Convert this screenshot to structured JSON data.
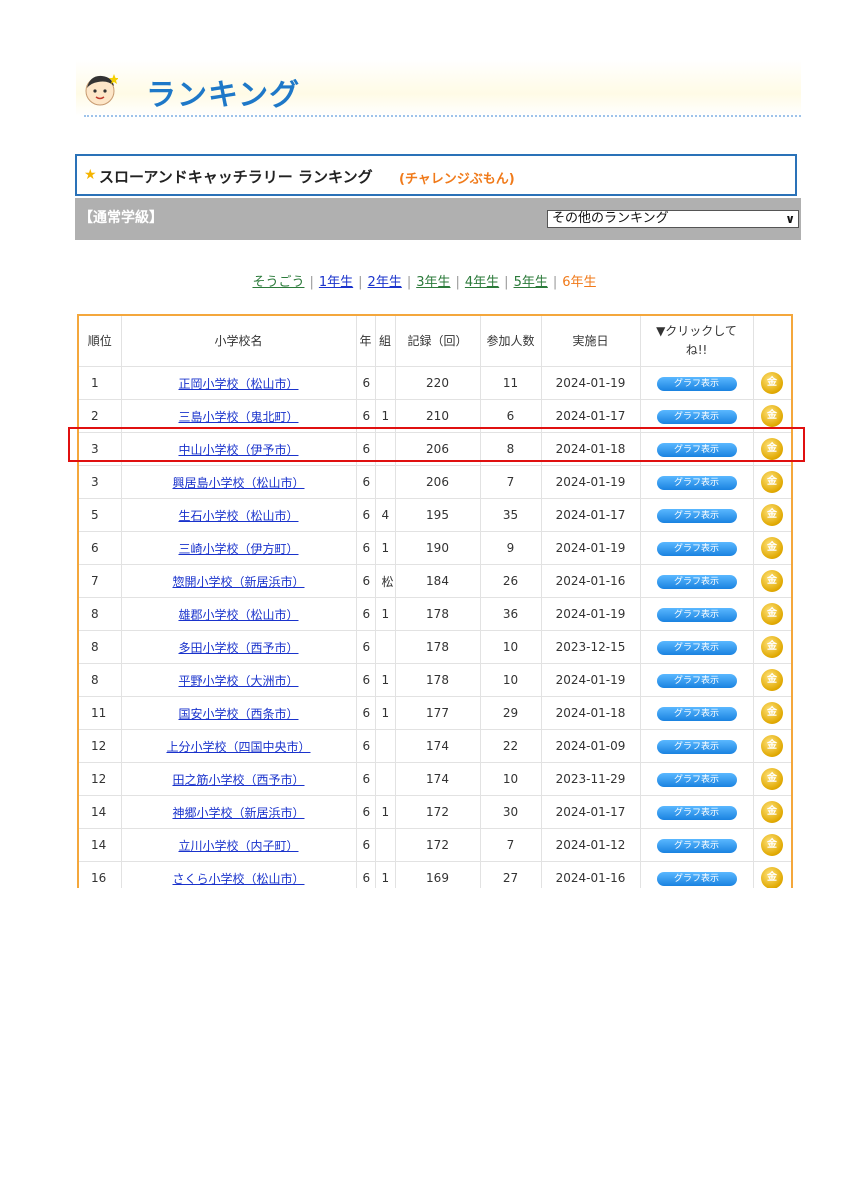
{
  "header": {
    "title": "ランキング"
  },
  "ranking_box": {
    "title": "スローアンドキャッチラリー ランキング",
    "subtitle": "(チャレンジぶもん)"
  },
  "class_bar": {
    "label": "【通常学級】",
    "select_value": "その他のランキング"
  },
  "grade_nav": [
    {
      "label": "そうごう",
      "style": "green"
    },
    {
      "label": "1年生",
      "style": "blue"
    },
    {
      "label": "2年生",
      "style": "blue"
    },
    {
      "label": "3年生",
      "style": "green"
    },
    {
      "label": "4年生",
      "style": "green"
    },
    {
      "label": "5年生",
      "style": "green"
    },
    {
      "label": "6年生",
      "style": "current"
    }
  ],
  "table": {
    "headers": [
      "順位",
      "小学校名",
      "年",
      "組",
      "記録（回）",
      "参加人数",
      "実施日",
      "▼クリックしてね!!",
      ""
    ],
    "graph_label": "グラフ表示",
    "medal_label": "金",
    "rows": [
      [
        "1",
        "正岡小学校（松山市）",
        "6",
        "",
        "220",
        "11",
        "2024-01-19"
      ],
      [
        "2",
        "三島小学校（鬼北町）",
        "6",
        "1",
        "210",
        "6",
        "2024-01-17"
      ],
      [
        "3",
        "中山小学校（伊予市）",
        "6",
        "",
        "206",
        "8",
        "2024-01-18"
      ],
      [
        "3",
        "興居島小学校（松山市）",
        "6",
        "",
        "206",
        "7",
        "2024-01-19"
      ],
      [
        "5",
        "生石小学校（松山市）",
        "6",
        "4",
        "195",
        "35",
        "2024-01-17"
      ],
      [
        "6",
        "三崎小学校（伊方町）",
        "6",
        "1",
        "190",
        "9",
        "2024-01-19"
      ],
      [
        "7",
        "惣開小学校（新居浜市）",
        "6",
        "松",
        "184",
        "26",
        "2024-01-16"
      ],
      [
        "8",
        "雄郡小学校（松山市）",
        "6",
        "1",
        "178",
        "36",
        "2024-01-19"
      ],
      [
        "8",
        "多田小学校（西予市）",
        "6",
        "",
        "178",
        "10",
        "2023-12-15"
      ],
      [
        "8",
        "平野小学校（大洲市）",
        "6",
        "1",
        "178",
        "10",
        "2024-01-19"
      ],
      [
        "11",
        "国安小学校（西条市）",
        "6",
        "1",
        "177",
        "29",
        "2024-01-18"
      ],
      [
        "12",
        "上分小学校（四国中央市）",
        "6",
        "",
        "174",
        "22",
        "2024-01-09"
      ],
      [
        "12",
        "田之筋小学校（西予市）",
        "6",
        "",
        "174",
        "10",
        "2023-11-29"
      ],
      [
        "14",
        "神郷小学校（新居浜市）",
        "6",
        "1",
        "172",
        "30",
        "2024-01-17"
      ],
      [
        "14",
        "立川小学校（内子町）",
        "6",
        "",
        "172",
        "7",
        "2024-01-12"
      ],
      [
        "16",
        "さくら小学校（松山市）",
        "6",
        "1",
        "169",
        "27",
        "2024-01-16"
      ]
    ]
  }
}
